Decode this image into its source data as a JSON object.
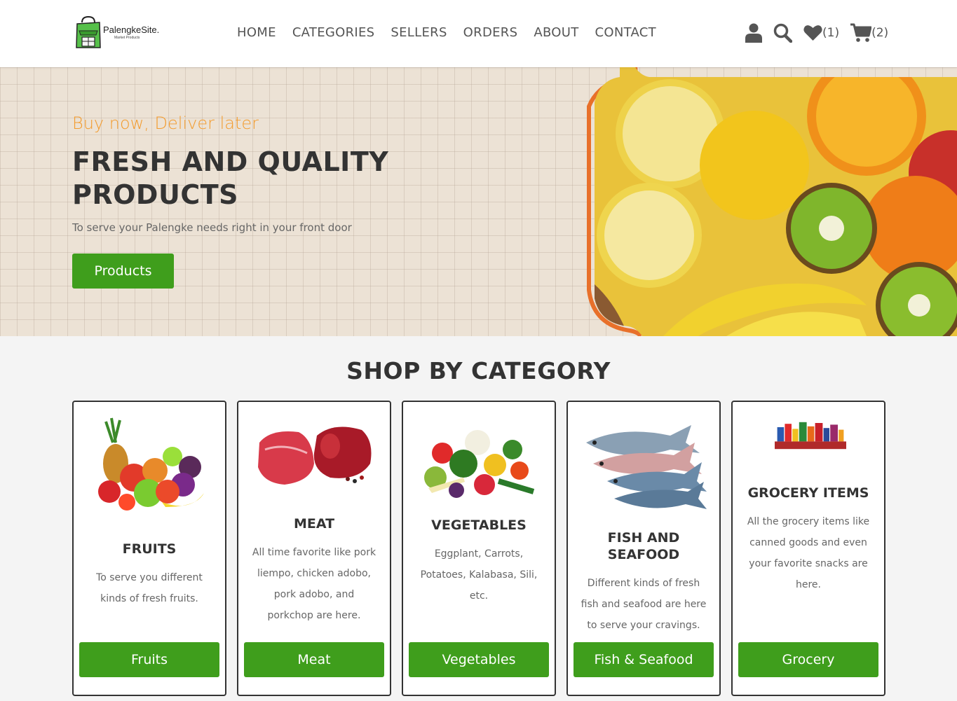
{
  "brand": {
    "name": "PalengkeSite.",
    "tagline": "Market Products"
  },
  "nav": [
    "HOME",
    "CATEGORIES",
    "SELLERS",
    "ORDERS",
    "ABOUT",
    "CONTACT"
  ],
  "header_icons": {
    "account_icon": "user-icon",
    "search_icon": "search-icon",
    "wishlist_icon": "heart-icon",
    "wishlist_count": "(1)",
    "cart_icon": "cart-icon",
    "cart_count": "(2)"
  },
  "hero": {
    "kicker": "Buy now, Deliver later",
    "title": "FRESH AND QUALITY PRODUCTS",
    "subtitle": "To serve your Palengke needs right in your front door",
    "button": "Products"
  },
  "categories_section": {
    "title": "SHOP BY CATEGORY",
    "items": [
      {
        "name": "FRUITS",
        "description": "To serve you different kinds of fresh fruits.",
        "button": "Fruits"
      },
      {
        "name": "MEAT",
        "description": "All time favorite like pork liempo, chicken adobo, pork adobo, and porkchop are here.",
        "button": "Meat"
      },
      {
        "name": "VEGETABLES",
        "description": "Eggplant, Carrots, Potatoes, Kalabasa, Sili, etc.",
        "button": "Vegetables"
      },
      {
        "name": "FISH AND SEAFOOD",
        "description": "Different kinds of fresh fish and seafood are here to serve your cravings.",
        "button": "Fish & Seafood"
      },
      {
        "name": "GROCERY ITEMS",
        "description": "All the grocery items like canned goods and even your favorite snacks are here.",
        "button": "Grocery"
      }
    ]
  },
  "colors": {
    "accent_green": "#3f9e1c",
    "accent_orange": "#f39b2d",
    "hero_frame": "#e8702a"
  }
}
